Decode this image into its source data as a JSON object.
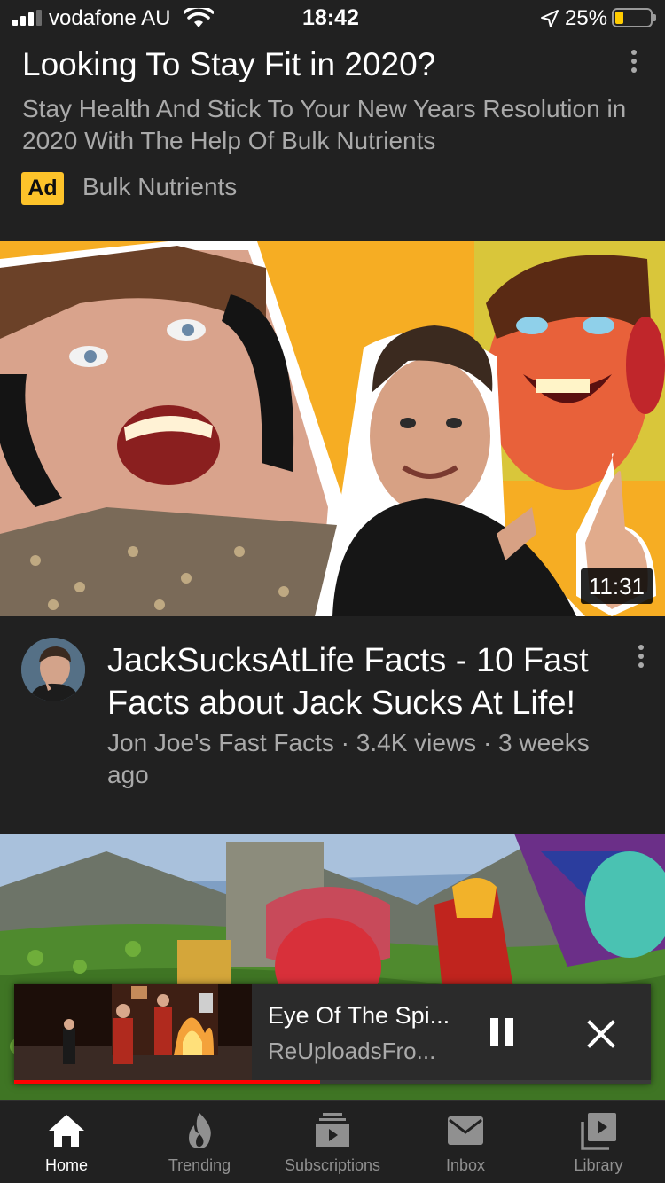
{
  "status_bar": {
    "carrier": "vodafone AU",
    "time": "18:42",
    "battery_percent_text": "25%",
    "battery_level": 0.25,
    "signal_bars": 3,
    "signal_bars_total": 4
  },
  "ad": {
    "title": "Looking To Stay Fit in 2020?",
    "description": "Stay Health And Stick To Your New Years Resolution in 2020 With The Help Of Bulk Nutrients",
    "badge": "Ad",
    "advertiser": "Bulk Nutrients",
    "badge_color": "#fdc32a"
  },
  "video": {
    "duration": "11:31",
    "title": "JackSucksAtLife Facts - 10 Fast Facts about Jack Sucks At Life!",
    "meta": "Jon Joe's Fast Facts · 3.4K views · 3 weeks ago"
  },
  "miniplayer": {
    "title": "Eye Of The Spi...",
    "channel": "ReUploadsFro...",
    "progress": 0.48,
    "progress_color": "#ff0000"
  },
  "nav": {
    "items": [
      {
        "label": "Home",
        "icon": "home-icon",
        "active": true
      },
      {
        "label": "Trending",
        "icon": "flame-icon",
        "active": false
      },
      {
        "label": "Subscriptions",
        "icon": "subscriptions-icon",
        "active": false
      },
      {
        "label": "Inbox",
        "icon": "mail-icon",
        "active": false
      },
      {
        "label": "Library",
        "icon": "library-icon",
        "active": false
      }
    ]
  }
}
